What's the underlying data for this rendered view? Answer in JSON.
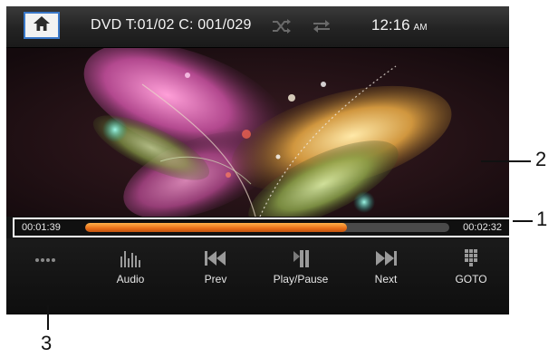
{
  "header": {
    "home_icon": "home-icon",
    "title": "DVD T:01/02 C: 001/029",
    "shuffle_icon": "shuffle-icon",
    "repeat_icon": "repeat-icon",
    "time": "12:16",
    "ampm": "AM"
  },
  "progress": {
    "elapsed": "00:01:39",
    "total": "00:02:32",
    "fraction": 0.72
  },
  "controls": [
    {
      "label": "",
      "icon": "more-dots-icon"
    },
    {
      "label": "Audio",
      "icon": "audio-icon"
    },
    {
      "label": "Prev",
      "icon": "prev-icon"
    },
    {
      "label": "Play/Pause",
      "icon": "play-pause-icon"
    },
    {
      "label": "Next",
      "icon": "next-icon"
    },
    {
      "label": "GOTO",
      "icon": "goto-icon"
    }
  ],
  "callouts": {
    "one": "1",
    "two": "2",
    "three": "3"
  },
  "colors": {
    "accent_border": "#3a78c8",
    "progress_fill": "#e86e18",
    "background": "#141414"
  }
}
